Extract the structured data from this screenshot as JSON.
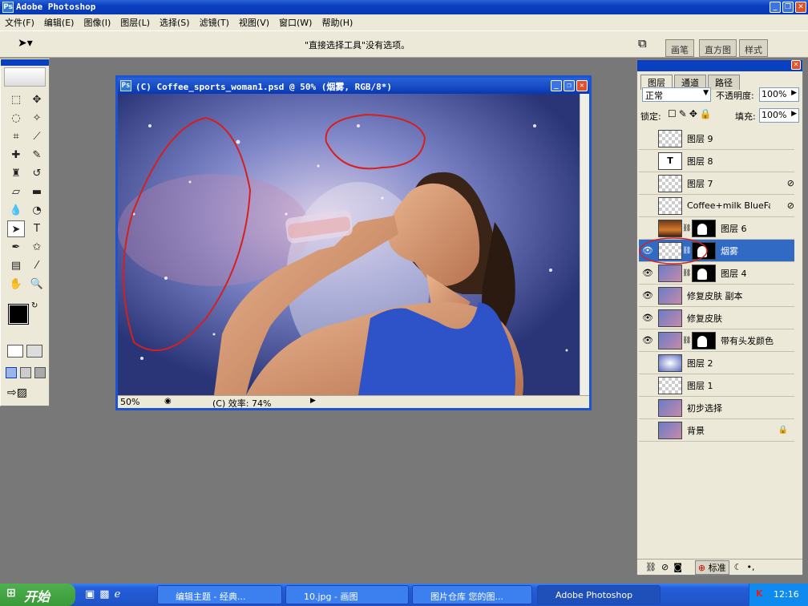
{
  "app": {
    "title": "Adobe Photoshop"
  },
  "menu": [
    "文件(F)",
    "编辑(E)",
    "图像(I)",
    "图层(L)",
    "选择(S)",
    "滤镜(T)",
    "视图(V)",
    "窗口(W)",
    "帮助(H)"
  ],
  "options_bar": {
    "hint": "\"直接选择工具\"没有选项。",
    "palette_tabs": [
      "画笔",
      "直方图",
      "样式"
    ]
  },
  "document": {
    "title": "(C) Coffee_sports_woman1.psd @ 50% (烟雾, RGB/8*)",
    "zoom": "50%",
    "status": "(C) 效率: 74%"
  },
  "layers_panel": {
    "tabs": [
      "图层",
      "通道",
      "路径"
    ],
    "blend_mode": "正常",
    "opacity_label": "不透明度:",
    "opacity": "100%",
    "lock_label": "锁定:",
    "fill_label": "填充:",
    "fill": "100%",
    "layers": [
      {
        "name": "图层 9",
        "visible": false
      },
      {
        "name": "图层 8",
        "visible": false,
        "type": "text"
      },
      {
        "name": "图层 7",
        "visible": false
      },
      {
        "name": "Coffee+milk BlueFa...",
        "visible": false
      },
      {
        "name": "图层 6",
        "visible": false,
        "mask": true
      },
      {
        "name": "烟雾",
        "visible": true,
        "mask": true,
        "selected": true
      },
      {
        "name": "图层 4",
        "visible": true,
        "mask": true
      },
      {
        "name": "修复皮肤 副本",
        "visible": true
      },
      {
        "name": "修复皮肤",
        "visible": true
      },
      {
        "name": "带有头发颜色",
        "visible": true,
        "mask": true
      },
      {
        "name": "图层 2",
        "visible": false
      },
      {
        "name": "图层 1",
        "visible": false
      },
      {
        "name": "初步选择",
        "visible": false
      },
      {
        "name": "背景",
        "visible": false,
        "locked": true
      }
    ],
    "footer_button": "标准"
  },
  "taskbar": {
    "start": "开始",
    "buttons": [
      "编辑主题 - 经典...",
      "10.jpg - 画图",
      "图片仓库 您的图...",
      "Adobe Photoshop"
    ],
    "clock": "12:16"
  }
}
